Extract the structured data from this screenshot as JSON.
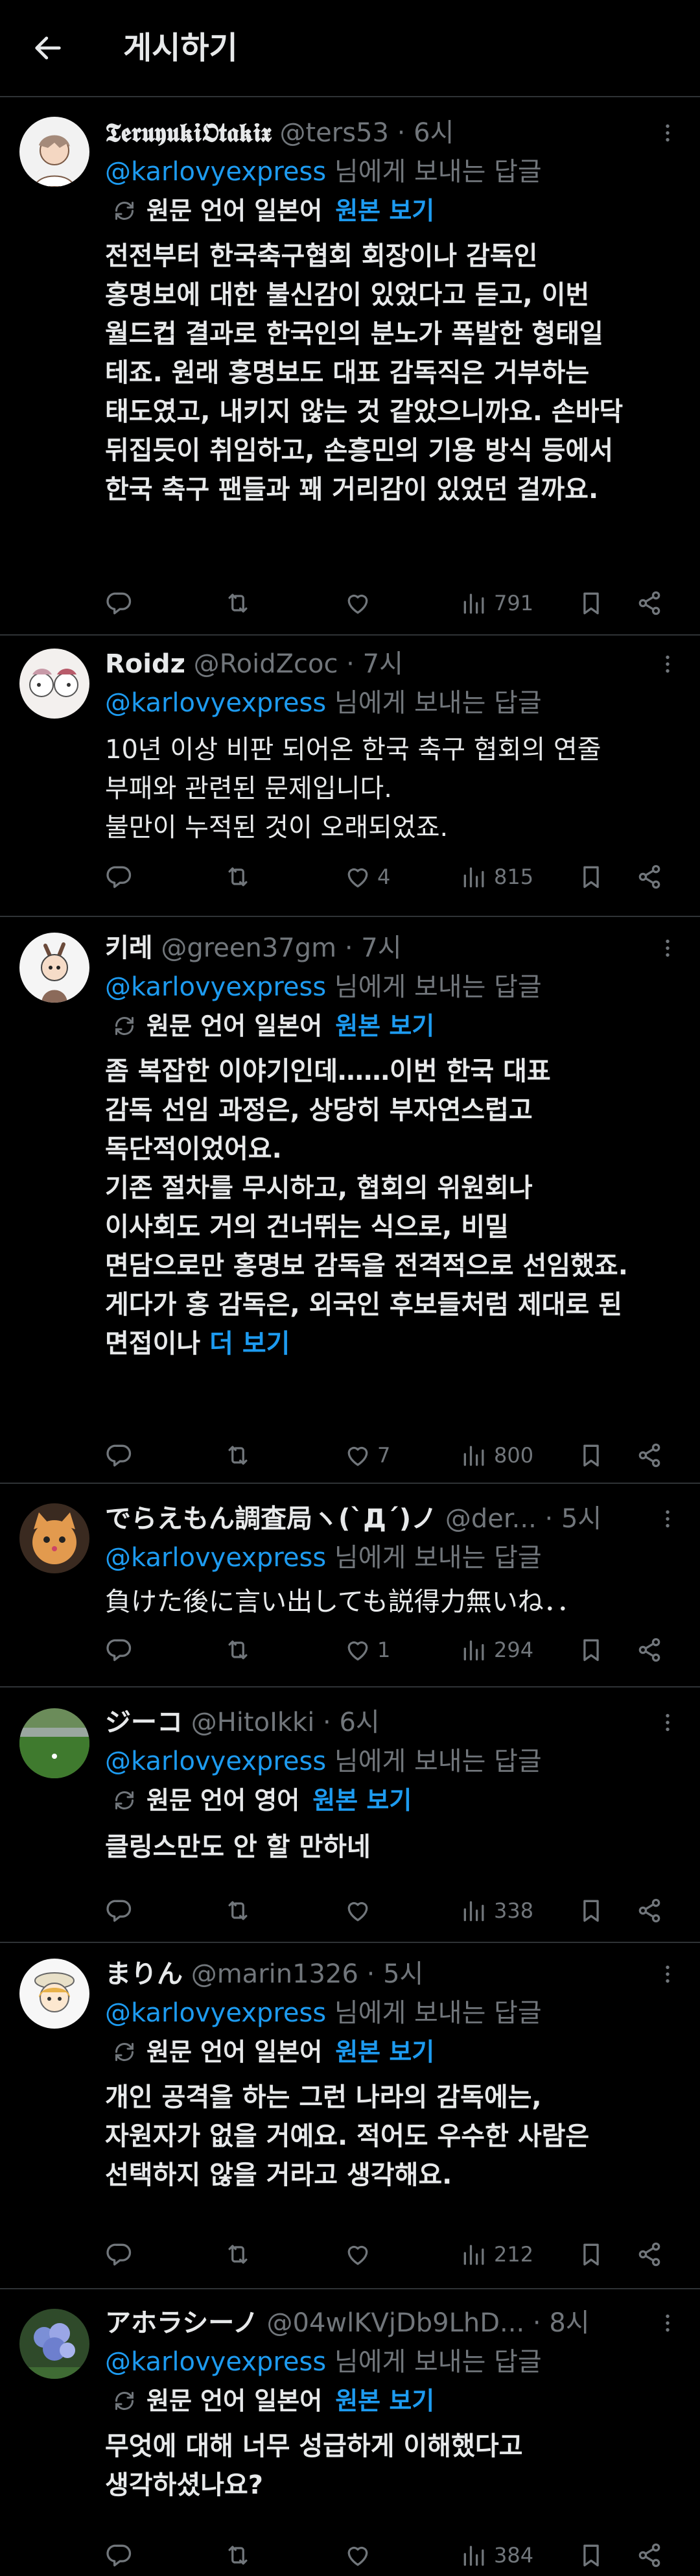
{
  "header": {
    "title": "게시하기"
  },
  "reply_to_suffix": "님에게 보내는 답글",
  "translate": {
    "show_original": "원본 보기"
  },
  "tweets": [
    {
      "name": "𝕿𝖊𝖗𝖚𝖞𝖚𝖐𝖎𝕺𝖙𝖆𝖐𝖎𝖝",
      "handle": "@ters53",
      "time": "6시",
      "reply_handle": "@karlovyexpress",
      "translate_label": "원문 언어 일본어",
      "text": "전전부터 한국축구협회 회장이나 감독인\n홍명보에 대한 불신감이 있었다고 듣고, 이번\n월드컵 결과로 한국인의 분노가 폭발한 형태일\n테죠. 원래 홍명보도 대표 감독직은 거부하는\n태도였고, 내키지 않는 것 같았으니까요. 손바닥\n뒤집듯이 취임하고, 손흥민의 기용 방식 등에서\n한국 축구 팬들과 꽤 거리감이 있었던 걸까요.",
      "likes": "",
      "views": "791"
    },
    {
      "name": "Roidz",
      "handle": "@RoidZcoc",
      "time": "7시",
      "reply_handle": "@karlovyexpress",
      "text": "10년 이상 비판 되어온 한국 축구 협회의 연줄\n부패와 관련된 문제입니다.\n불만이 누적된 것이 오래되었죠.",
      "likes": "4",
      "views": "815"
    },
    {
      "name": "키레",
      "handle": "@green37gm",
      "time": "7시",
      "reply_handle": "@karlovyexpress",
      "translate_label": "원문 언어 일본어",
      "text": "좀 복잡한 이야기인데……이번 한국 대표\n감독 선임 과정은, 상당히 부자연스럽고\n독단적이었어요.\n기존 절차를 무시하고, 협회의 위원회나\n이사회도 거의 건너뛰는 식으로, 비밀\n면담으로만 홍명보 감독을 전격적으로 선임했죠.\n게다가 홍 감독은, 외국인 후보들처럼 제대로 된\n면접이나 ",
      "show_more": "더 보기",
      "likes": "7",
      "views": "800"
    },
    {
      "name": "でらえもん調査局ヽ(`Д´)ノ",
      "handle": "@der...",
      "time": "5시",
      "reply_handle": "@karlovyexpress",
      "text": "負けた後に言い出しても説得力無いね．．",
      "likes": "1",
      "views": "294"
    },
    {
      "name": "ジーコ",
      "handle": "@HitoIkki",
      "time": "6시",
      "reply_handle": "@karlovyexpress",
      "translate_label": "원문 언어 영어",
      "text": "클링스만도 안 할 만하네",
      "likes": "",
      "views": "338"
    },
    {
      "name": "まりん",
      "handle": "@marin1326",
      "time": "5시",
      "reply_handle": "@karlovyexpress",
      "translate_label": "원문 언어 일본어",
      "text": "개인 공격을 하는 그런 나라의 감독에는,\n자원자가 없을 거예요. 적어도 우수한 사람은\n선택하지 않을 거라고 생각해요.",
      "likes": "",
      "views": "212"
    },
    {
      "name": "アホラシーノ",
      "handle": "@04wlKVjDb9LhD...",
      "time": "8시",
      "reply_handle": "@karlovyexpress",
      "translate_label": "원문 언어 일본어",
      "text": "무엇에 대해 너무 성급하게 이해했다고\n생각하셨나요?",
      "likes": "",
      "views": "384"
    }
  ]
}
